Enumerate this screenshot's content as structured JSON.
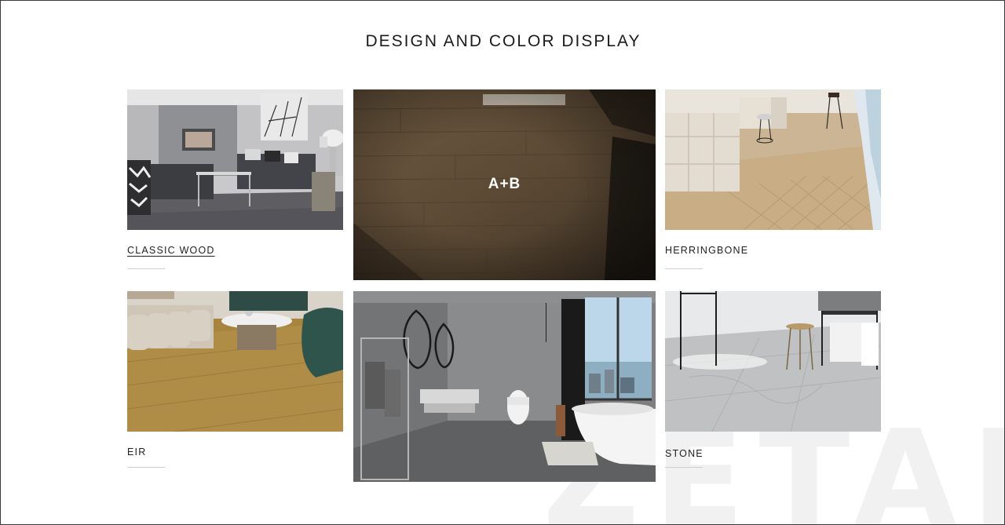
{
  "header": {
    "title": "DESIGN AND COLOR DISPLAY"
  },
  "cards": {
    "classic_wood": {
      "label": "CLASSIC WOOD",
      "image": "living-room-grey-floor"
    },
    "herringbone": {
      "label": "HERRINGBONE",
      "image": "living-room-herringbone-floor"
    },
    "eir": {
      "label": "EIR",
      "image": "living-room-oak-floor"
    },
    "stone": {
      "label": "STONE",
      "image": "room-grey-stone-floor"
    }
  },
  "feature_top": {
    "overlay": "A+B",
    "image": "wood-plank-floor-closeup"
  },
  "feature_bottom": {
    "image": "grey-marble-bathroom"
  },
  "watermark": {
    "text": "ZETAI"
  }
}
